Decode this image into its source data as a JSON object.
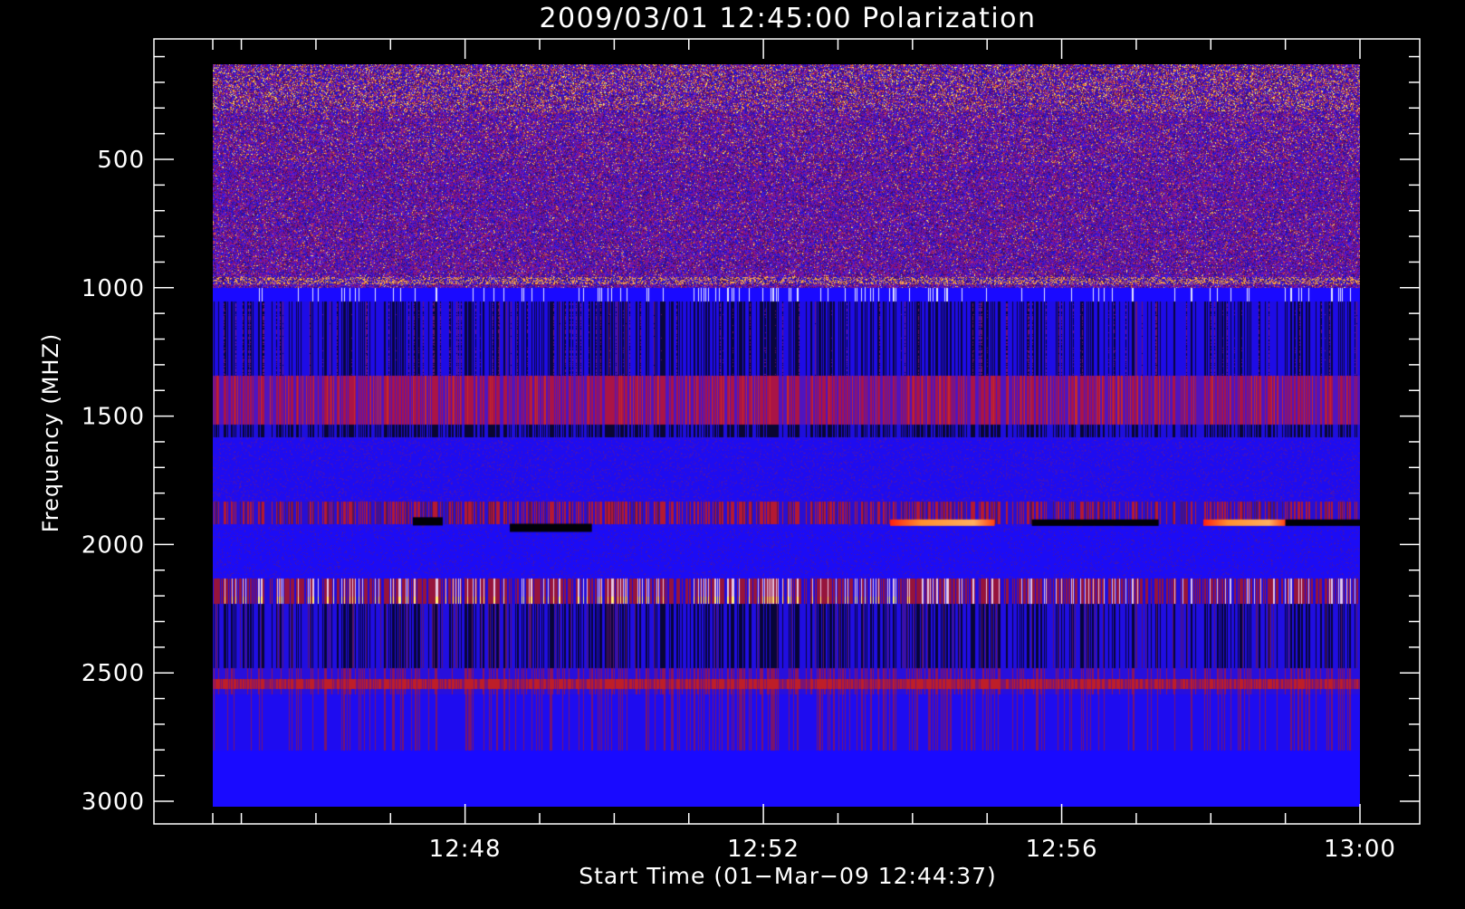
{
  "chart_data": {
    "type": "heatmap",
    "title": "2009/03/01  12:45:00 Polarization",
    "xlabel": "Start Time (01−Mar−09 12:44:37)",
    "ylabel": "Frequency (MHZ)",
    "x_ticks": [
      "12:48",
      "12:52",
      "12:56",
      "13:00"
    ],
    "x_tick_minutes": [
      48,
      52,
      56,
      60
    ],
    "y_ticks": [
      "500",
      "1000",
      "1500",
      "2000",
      "2500",
      "3000"
    ],
    "y_tick_values": [
      500,
      1000,
      1500,
      2000,
      2500,
      3000
    ],
    "xlim_minutes": [
      44.6167,
      60
    ],
    "data_time_range_minutes": [
      44.6167,
      60
    ],
    "ylim": [
      3000,
      100
    ],
    "y_axis_inverted": true,
    "frequency_range_mhz": [
      130,
      3020
    ],
    "colors": {
      "background": "#000000",
      "axis": "#ffffff",
      "base": "#1a0aff",
      "dark": "#000030",
      "red": "#a01010",
      "orange": "#ff8020",
      "yellow": "#ffff60"
    },
    "bands": [
      {
        "from_mhz": 130,
        "to_mhz": 1000,
        "pattern": "noisy",
        "note": "mixed purple, orange, yellow speckle"
      },
      {
        "from_mhz": 1000,
        "to_mhz": 1050,
        "pattern": "ticks",
        "color": "white"
      },
      {
        "from_mhz": 1050,
        "to_mhz": 1340,
        "pattern": "dark stripes"
      },
      {
        "from_mhz": 1340,
        "to_mhz": 1530,
        "pattern": "red stripes"
      },
      {
        "from_mhz": 1530,
        "to_mhz": 1580,
        "pattern": "dark stripes"
      },
      {
        "from_mhz": 1580,
        "to_mhz": 1830,
        "pattern": "blue"
      },
      {
        "from_mhz": 1830,
        "to_mhz": 1920,
        "pattern": "red stripes"
      },
      {
        "from_mhz": 2130,
        "to_mhz": 2230,
        "pattern": "white/yellow ticks"
      },
      {
        "from_mhz": 2230,
        "to_mhz": 2480,
        "pattern": "dark stripes"
      },
      {
        "from_mhz": 2480,
        "to_mhz": 2580,
        "pattern": "red stripes"
      },
      {
        "from_mhz": 2580,
        "to_mhz": 2800,
        "pattern": "faint red"
      },
      {
        "from_mhz": 2800,
        "to_mhz": 3020,
        "pattern": "solid blue"
      }
    ],
    "features": [
      {
        "type": "bright_line",
        "freq_mhz": 1915,
        "from_min": 53.7,
        "to_min": 55.1,
        "color": "orange"
      },
      {
        "type": "dark_line",
        "freq_mhz": 1915,
        "from_min": 55.6,
        "to_min": 57.3,
        "color": "black"
      },
      {
        "type": "bright_line",
        "freq_mhz": 1915,
        "from_min": 57.9,
        "to_min": 59.0,
        "color": "orange"
      },
      {
        "type": "dark_line",
        "freq_mhz": 1915,
        "from_min": 59.0,
        "to_min": 60.0,
        "color": "black"
      },
      {
        "type": "dark_blob",
        "freq_mhz": 1935,
        "from_min": 48.6,
        "to_min": 49.7,
        "color": "black"
      },
      {
        "type": "dark_blob",
        "freq_mhz": 1910,
        "from_min": 47.3,
        "to_min": 47.7,
        "color": "black"
      }
    ]
  }
}
